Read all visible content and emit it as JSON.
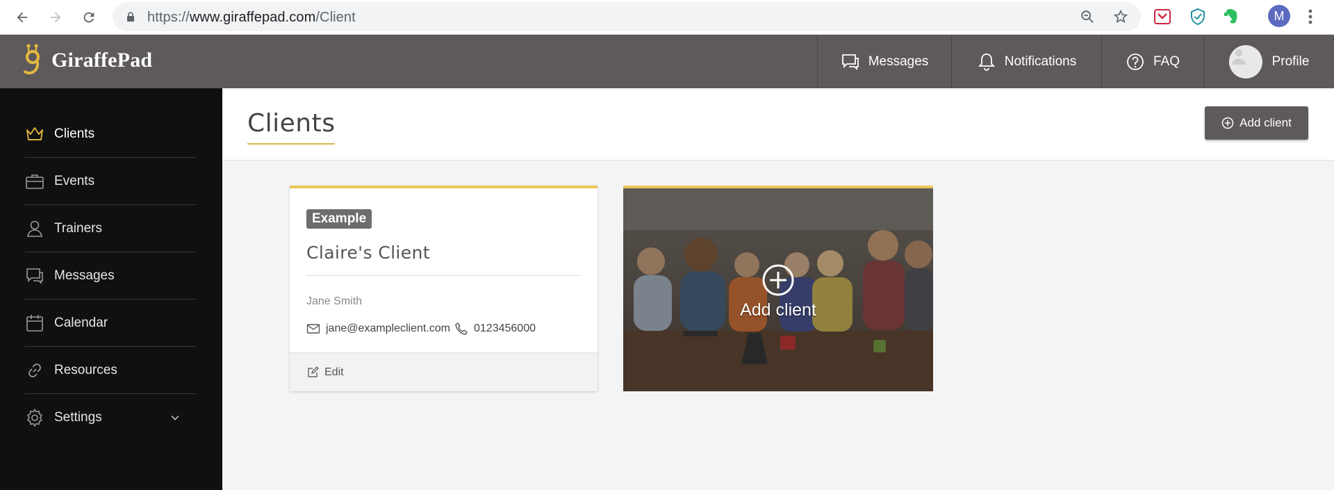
{
  "browser": {
    "url_proto": "https://",
    "url_host": "www.giraffepad.com",
    "url_path": "/Client",
    "profile_initial": "M"
  },
  "header": {
    "logo_text": "GiraffePad",
    "nav": [
      {
        "label": "Messages",
        "icon": "chat-icon"
      },
      {
        "label": "Notifications",
        "icon": "bell-icon"
      },
      {
        "label": "FAQ",
        "icon": "question-icon"
      },
      {
        "label": "Profile",
        "icon": "avatar"
      }
    ]
  },
  "sidebar": {
    "items": [
      {
        "label": "Clients",
        "icon": "crown-icon",
        "active": true
      },
      {
        "label": "Events",
        "icon": "briefcase-icon"
      },
      {
        "label": "Trainers",
        "icon": "user-icon"
      },
      {
        "label": "Messages",
        "icon": "chat-icon"
      },
      {
        "label": "Calendar",
        "icon": "calendar-icon"
      },
      {
        "label": "Resources",
        "icon": "link-icon"
      },
      {
        "label": "Settings",
        "icon": "gear-icon"
      }
    ]
  },
  "page": {
    "title": "Clients",
    "add_button": "Add client"
  },
  "client_card": {
    "badge": "Example",
    "name": "Claire's Client",
    "contact_name": "Jane Smith",
    "email": "jane@exampleclient.com",
    "phone": "0123456000",
    "edit_label": "Edit"
  },
  "add_tile": {
    "label": "Add client"
  },
  "colors": {
    "header_bg": "#5e595a",
    "sidebar_bg": "#101010",
    "accent_gold": "#ecc85a"
  }
}
